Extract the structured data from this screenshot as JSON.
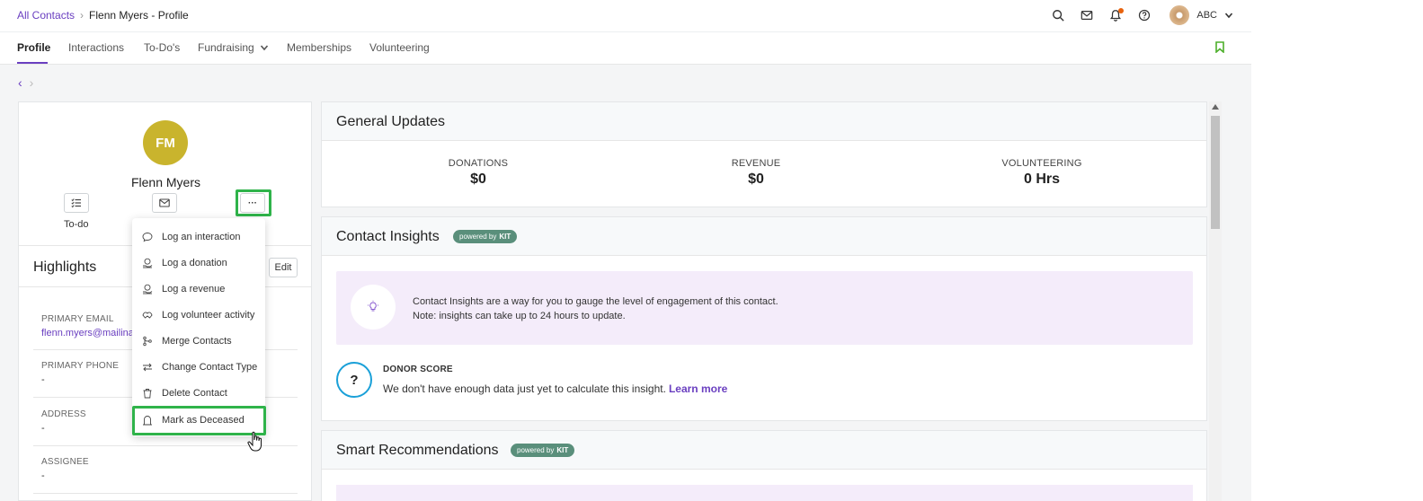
{
  "breadcrumb": {
    "root": "All Contacts",
    "separator": "›",
    "current": "Flenn Myers - Profile"
  },
  "header": {
    "user_initials": "ABC",
    "icons": [
      "search-icon",
      "mail-icon",
      "bell-icon",
      "help-icon"
    ]
  },
  "tabs": [
    {
      "label": "Profile",
      "active": true
    },
    {
      "label": "Interactions"
    },
    {
      "label": "To-Do's"
    },
    {
      "label": "Fundraising",
      "has_dropdown": true
    },
    {
      "label": "Memberships"
    },
    {
      "label": "Volunteering"
    }
  ],
  "pager": {
    "prev": "‹",
    "next": "›"
  },
  "profile": {
    "initials": "FM",
    "avatar_color": "#c9b42d",
    "name": "Flenn Myers",
    "todo_label": "To-do",
    "more_label": "···"
  },
  "highlights": {
    "title": "Highlights",
    "edit_label": "Edit",
    "fields": [
      {
        "label": "PRIMARY EMAIL",
        "value": "flenn.myers@mailina"
      },
      {
        "label": "PRIMARY PHONE",
        "value": "-"
      },
      {
        "label": "ADDRESS",
        "value": "-"
      },
      {
        "label": "ASSIGNEE",
        "value": "-"
      }
    ]
  },
  "menu": {
    "items": [
      {
        "label": "Log an interaction",
        "icon": "chat-icon"
      },
      {
        "label": "Log a donation",
        "icon": "donation-icon"
      },
      {
        "label": "Log a revenue",
        "icon": "revenue-icon"
      },
      {
        "label": "Log volunteer activity",
        "icon": "volunteer-icon"
      },
      {
        "label": "Merge Contacts",
        "icon": "merge-icon"
      },
      {
        "label": "Change Contact Type",
        "icon": "swap-icon"
      },
      {
        "label": "Delete Contact",
        "icon": "trash-icon"
      },
      {
        "label": "Mark as Deceased",
        "icon": "tombstone-icon"
      }
    ]
  },
  "general_updates": {
    "title": "General Updates",
    "stats": [
      {
        "label": "DONATIONS",
        "value": "$0"
      },
      {
        "label": "REVENUE",
        "value": "$0"
      },
      {
        "label": "VOLUNTEERING",
        "value": "0 Hrs"
      }
    ]
  },
  "contact_insights": {
    "title": "Contact Insights",
    "badge": {
      "prefix": "powered by",
      "brand": "KIT"
    },
    "info_line1": "Contact Insights are a way for you to gauge the level of engagement of this contact.",
    "info_line2": "Note: insights can take up to 24 hours to update.",
    "donor_score_label": "DONOR SCORE",
    "donor_score_symbol": "?",
    "donor_score_text": "We don't have enough data just yet to calculate this insight.",
    "learn_more": "Learn more"
  },
  "smart_recommendations": {
    "title": "Smart Recommendations",
    "badge": {
      "prefix": "powered by",
      "brand": "KIT"
    }
  },
  "colors": {
    "accent": "#6a3fc0",
    "highlight": "#2fb34a",
    "kit_badge": "#5a8f7b",
    "insight_bg": "#f4ecfa"
  }
}
